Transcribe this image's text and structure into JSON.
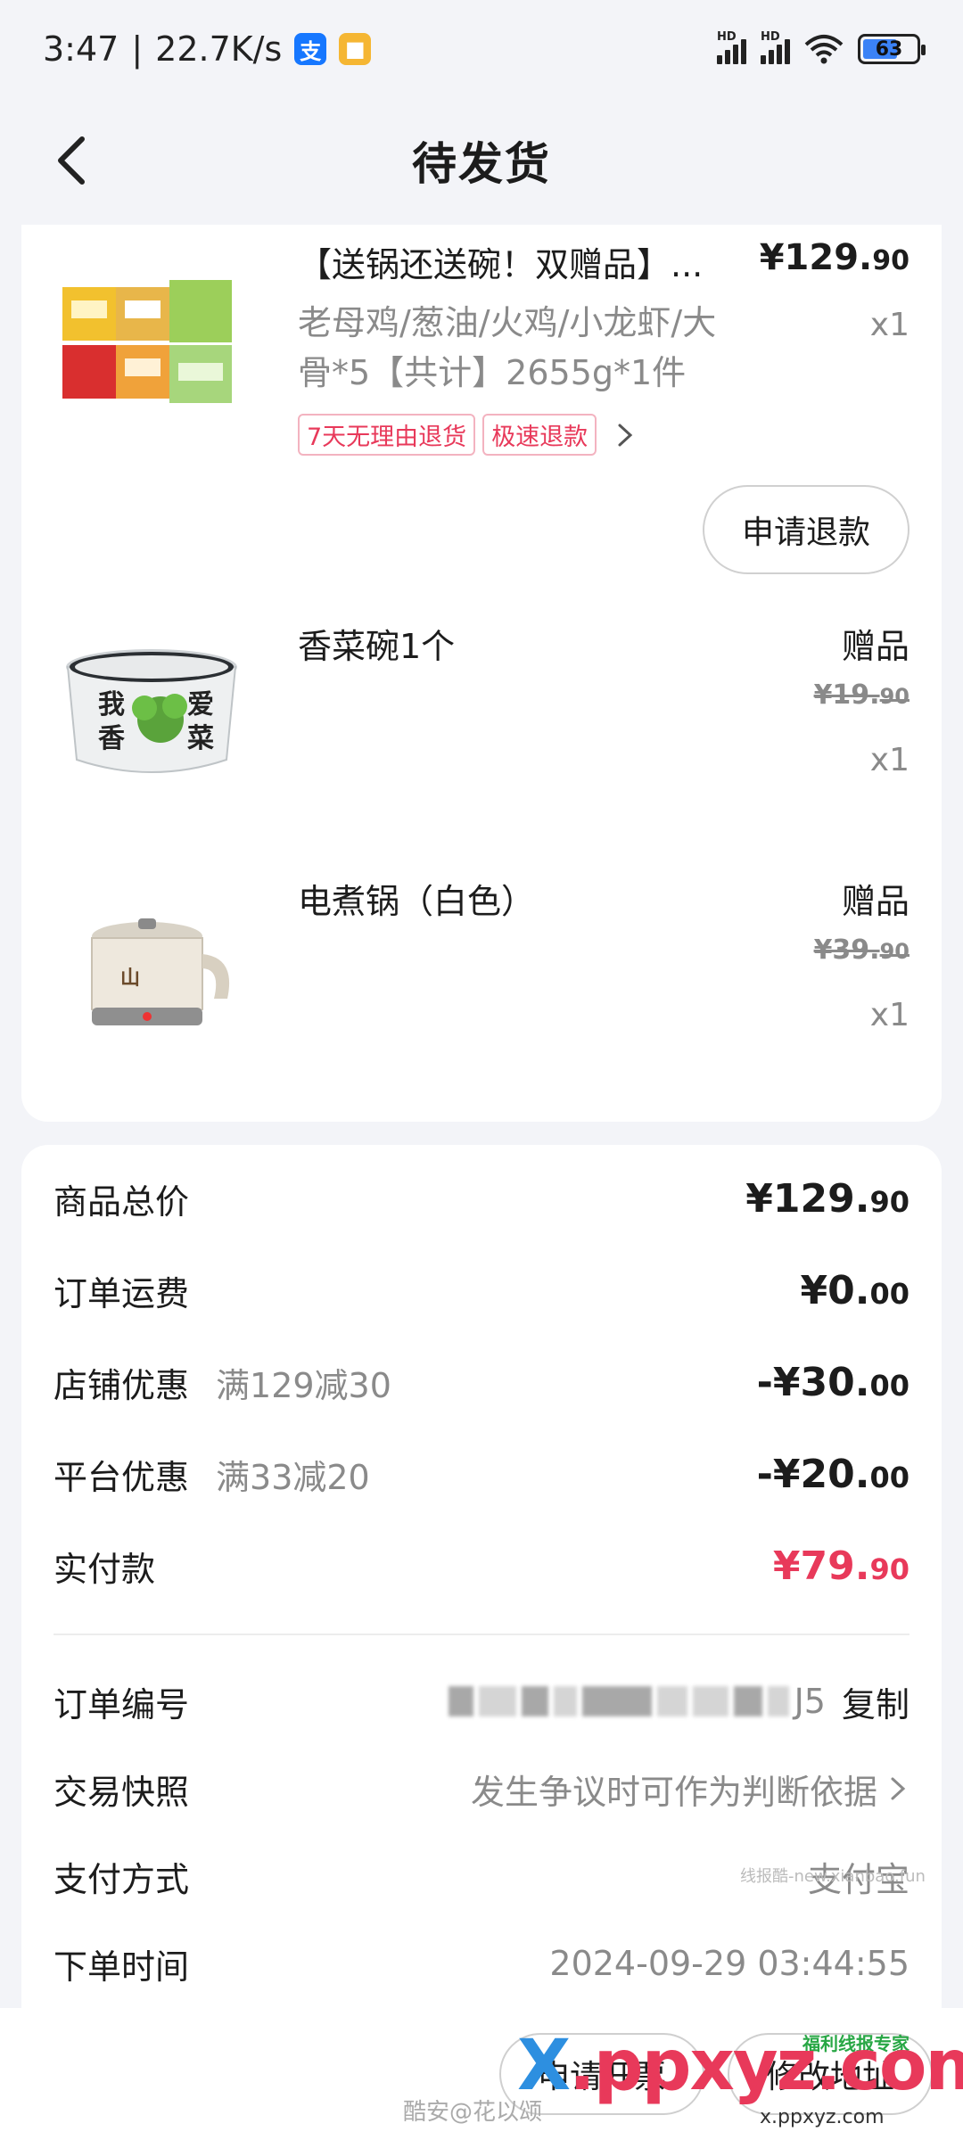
{
  "status_bar": {
    "time": "3:47",
    "speed": "22.7K/s",
    "alipay_icon": "alipay-icon",
    "app_icon": "notes-icon",
    "hd1": "HD",
    "hd2": "HD",
    "battery": "63"
  },
  "header": {
    "title": "待发货",
    "back_icon": "chevron-left-icon"
  },
  "products": [
    {
      "title": "【送锅还送碗！双赠品】...",
      "spec": "老母鸡/葱油/火鸡/小龙虾/大骨*5【共计】2655g*1件",
      "price_main": "¥129.",
      "price_cents": "90",
      "qty": "x1",
      "tags": [
        "7天无理由退货",
        "极速退款"
      ],
      "refund_button": "申请退款"
    },
    {
      "title": "香菜碗1个",
      "gift": "赠品",
      "orig_main": "¥19.",
      "orig_cents": "90",
      "qty": "x1",
      "image_text_1": "我",
      "image_text_2": "爱",
      "image_text_3": "香",
      "image_text_4": "菜"
    },
    {
      "title": "电煮锅（白色）",
      "gift": "赠品",
      "orig_main": "¥39.",
      "orig_cents": "90",
      "qty": "x1"
    }
  ],
  "summary": {
    "goods_total_label": "商品总价",
    "goods_total_main": "¥129.",
    "goods_total_cents": "90",
    "shipping_label": "订单运费",
    "shipping_main": "¥0.",
    "shipping_cents": "00",
    "store_discount_label": "店铺优惠",
    "store_discount_rule": "满129减30",
    "store_discount_main": "-¥30.",
    "store_discount_cents": "00",
    "platform_discount_label": "平台优惠",
    "platform_discount_rule": "满33减20",
    "platform_discount_main": "-¥20.",
    "platform_discount_cents": "00",
    "paid_label": "实付款",
    "paid_main": "¥79.",
    "paid_cents": "90",
    "order_no_label": "订单编号",
    "order_no_suffix": "J5",
    "copy_label": "复制",
    "snapshot_label": "交易快照",
    "snapshot_value": "发生争议时可作为判断依据",
    "pay_method_label": "支付方式",
    "pay_method_value": "支付宝",
    "order_time_label": "下单时间",
    "order_time_value": "2024-09-29 03:44:55"
  },
  "watermarks": {
    "mid": "线报酷-new.xianbao.fun",
    "badge": "福利线报专家",
    "logo_x": "X",
    "logo_rest": ".ppxyz.com",
    "logo_sub": "x.ppxyz.com",
    "credit": "酷安@花以颂"
  },
  "bottom_bar": {
    "left_button": "申请开票",
    "right_button": "修改地址"
  },
  "colors": {
    "accent": "#e8395a",
    "background": "#f3f4f8"
  }
}
